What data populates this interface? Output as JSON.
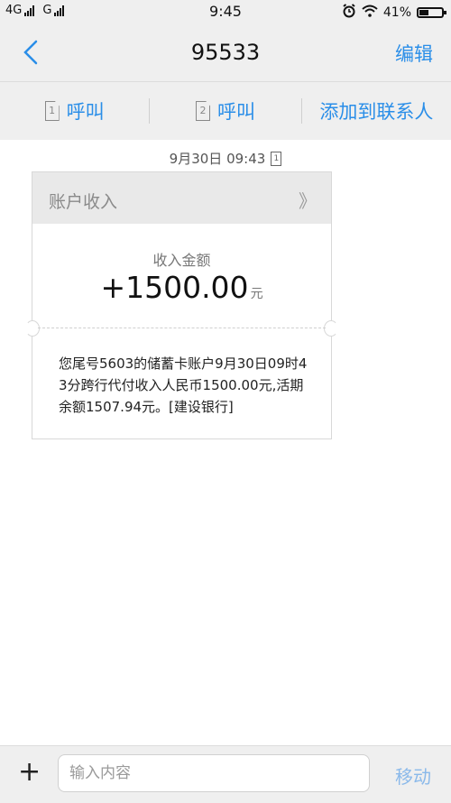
{
  "status_bar": {
    "sim1": "4G",
    "sim2": "G",
    "time": "9:45",
    "battery": "41%",
    "battery_level": 0.41
  },
  "nav": {
    "title": "95533",
    "edit_label": "编辑"
  },
  "actions": {
    "call1_sim": "1",
    "call1_label": "呼叫",
    "call2_sim": "2",
    "call2_label": "呼叫",
    "add_contact_label": "添加到联系人"
  },
  "message": {
    "timestamp": "9月30日  09:43",
    "sim_index": "1",
    "card_title": "账户收入",
    "card_chevron": "》",
    "amount_label": "收入金额",
    "amount_value": "+1500.00",
    "amount_unit": "元",
    "body": "您尾号5603的储蓄卡账户9月30日09时43分跨行代付收入人民币1500.00元,活期余额1507.94元。[建设银行]"
  },
  "compose": {
    "plus": "+",
    "placeholder": "输入内容",
    "send_label": "移动"
  },
  "colors": {
    "accent": "#2a8ee8",
    "bar_bg": "#efefef"
  }
}
